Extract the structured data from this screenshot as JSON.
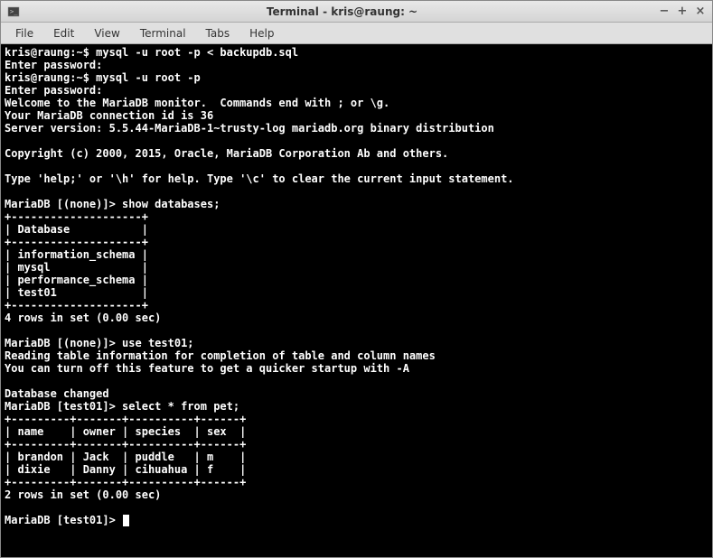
{
  "window": {
    "title": "Terminal - kris@raung: ~"
  },
  "menu": {
    "file": "File",
    "edit": "Edit",
    "view": "View",
    "terminal": "Terminal",
    "tabs": "Tabs",
    "help": "Help"
  },
  "terminal": {
    "line01": "kris@raung:~$ mysql -u root -p < backupdb.sql",
    "line02": "Enter password:",
    "line03": "kris@raung:~$ mysql -u root -p",
    "line04": "Enter password:",
    "line05": "Welcome to the MariaDB monitor.  Commands end with ; or \\g.",
    "line06": "Your MariaDB connection id is 36",
    "line07": "Server version: 5.5.44-MariaDB-1~trusty-log mariadb.org binary distribution",
    "line08": "",
    "line09": "Copyright (c) 2000, 2015, Oracle, MariaDB Corporation Ab and others.",
    "line10": "",
    "line11": "Type 'help;' or '\\h' for help. Type '\\c' to clear the current input statement.",
    "line12": "",
    "line13": "MariaDB [(none)]> show databases;",
    "line14": "+--------------------+",
    "line15": "| Database           |",
    "line16": "+--------------------+",
    "line17": "| information_schema |",
    "line18": "| mysql              |",
    "line19": "| performance_schema |",
    "line20": "| test01             |",
    "line21": "+--------------------+",
    "line22": "4 rows in set (0.00 sec)",
    "line23": "",
    "line24": "MariaDB [(none)]> use test01;",
    "line25": "Reading table information for completion of table and column names",
    "line26": "You can turn off this feature to get a quicker startup with -A",
    "line27": "",
    "line28": "Database changed",
    "line29": "MariaDB [test01]> select * from pet;",
    "line30": "+---------+-------+----------+------+",
    "line31": "| name    | owner | species  | sex  |",
    "line32": "+---------+-------+----------+------+",
    "line33": "| brandon | Jack  | puddle   | m    |",
    "line34": "| dixie   | Danny | cihuahua | f    |",
    "line35": "+---------+-------+----------+------+",
    "line36": "2 rows in set (0.00 sec)",
    "line37": "",
    "prompt": "MariaDB [test01]> "
  }
}
